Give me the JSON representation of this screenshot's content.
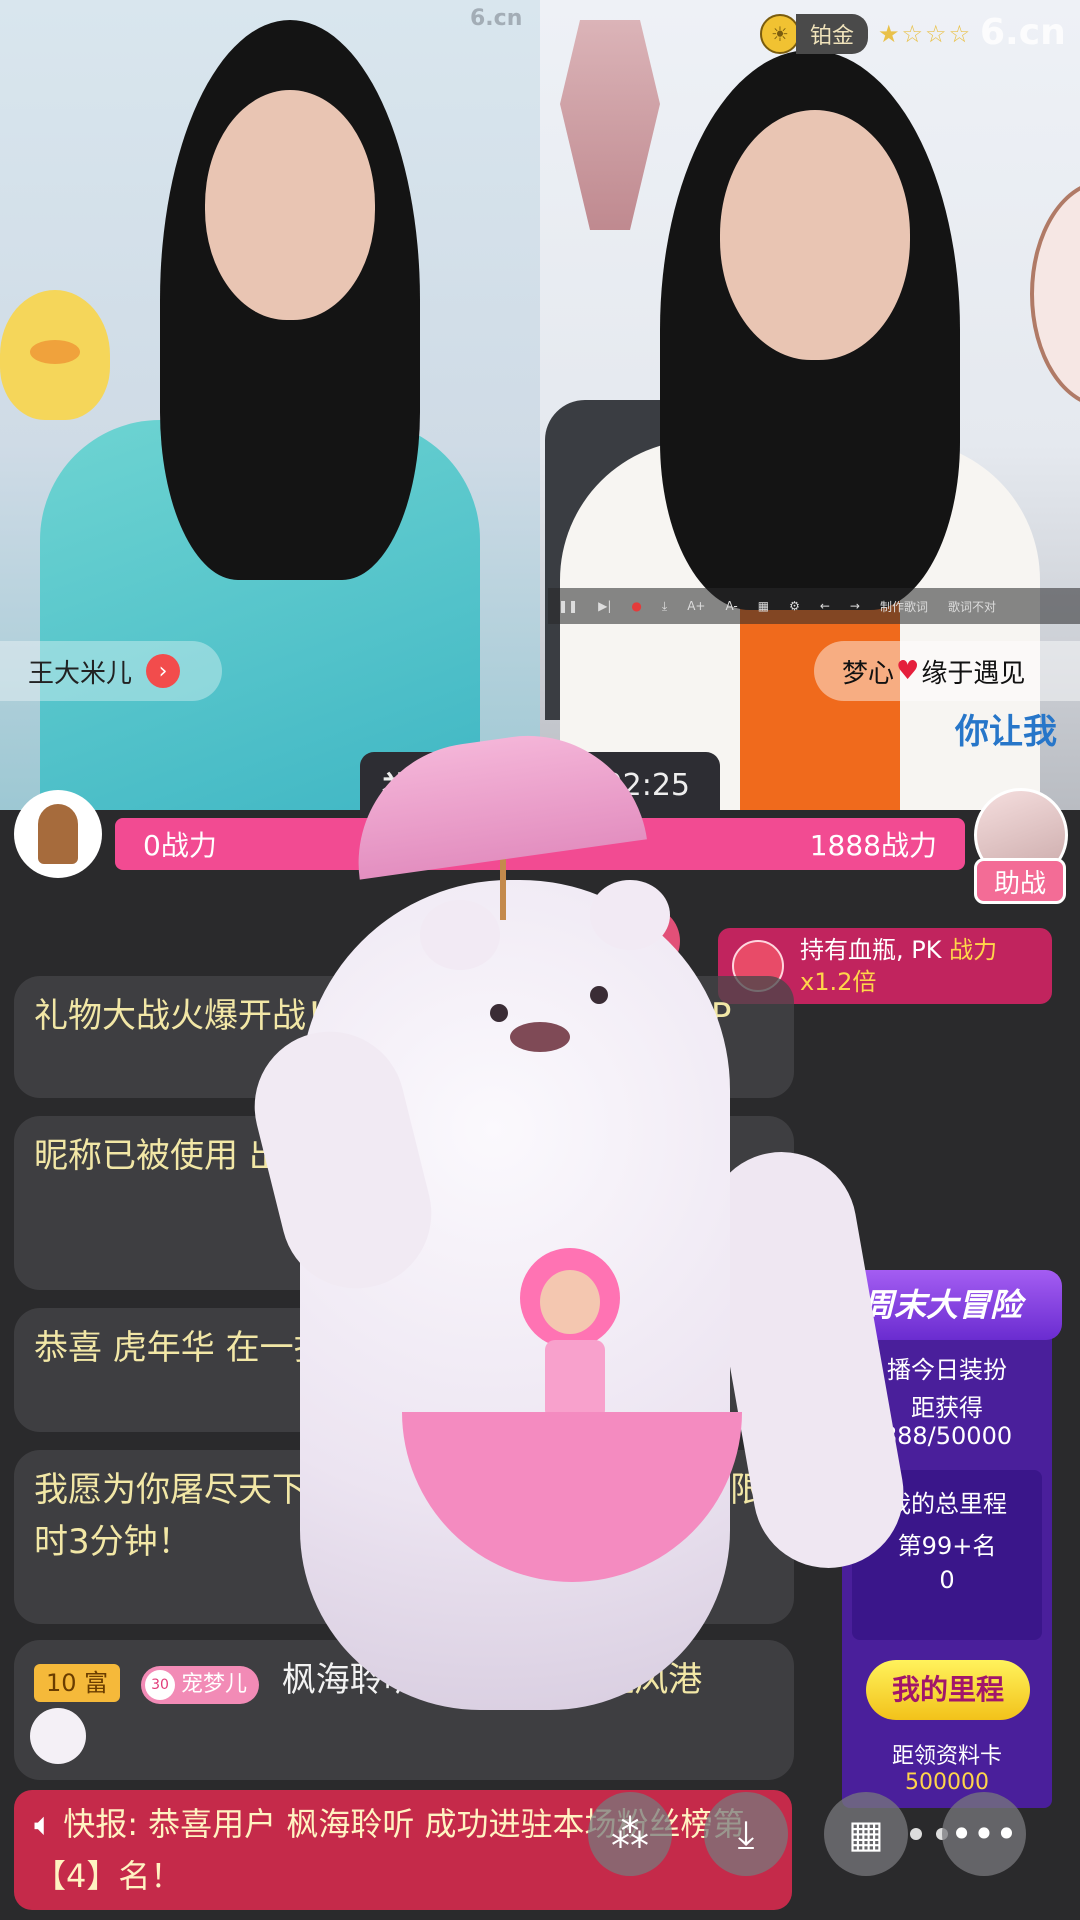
{
  "watermark": {
    "left": "6.cn",
    "right": "6.cn"
  },
  "rank_badge": {
    "label": "铂金",
    "stars": "★☆☆☆"
  },
  "player_toolbar": {
    "make_lyrics": "制作歌词",
    "lyrics_wrong": "歌词不对"
  },
  "streamers": {
    "left": {
      "name": "王大米儿"
    },
    "right": {
      "name_part1": "梦心",
      "name_part2": "缘于遇见",
      "lyric_overlay": "你让我"
    }
  },
  "center_badge": {
    "label": "礼物",
    "time": "02:25"
  },
  "pk": {
    "left_power": "0战力",
    "right_power": "1888战力",
    "help_button": "助战"
  },
  "blood_bottle": {
    "line1_prefix": "持有血瓶, PK ",
    "line1_highlight": "战力",
    "line2": "x1.2倍"
  },
  "chat": [
    {
      "text": "礼物大战火爆开战！30 高一方可获得血瓶道 P"
    },
    {
      "text": "昵称已被使用 出绽放礼物“百 放”限时3分钟"
    },
    {
      "text": "恭喜 虎年华 在一折 大礼包"
    },
    {
      "text": "我愿为你屠尽天下 家 房间拆出绽放礼 季绽放”限时3分钟！"
    }
  ],
  "gift_msg": {
    "rich_level": "10 富",
    "pet_level": "30",
    "pet_name": "宠梦儿",
    "user": "枫海聆听",
    "text": "送1个爱的避风港"
  },
  "adventure": {
    "title": "周末大冒险",
    "line1": "播今日装扮",
    "line2": "距获得",
    "line3": "888/50000",
    "total_label": "我的总里程",
    "rank": "第99+名",
    "distance": "0",
    "my_mileage_button": "我的里程",
    "card_label": "距领资料卡",
    "card_value": "500000"
  },
  "news": {
    "text": "快报: 恭喜用户 枫海聆听 成功进驻本场粉丝榜第【4】名！"
  },
  "bottom_buttons": [
    "share-icon",
    "download-icon",
    "grid-icon",
    "more-icon"
  ]
}
